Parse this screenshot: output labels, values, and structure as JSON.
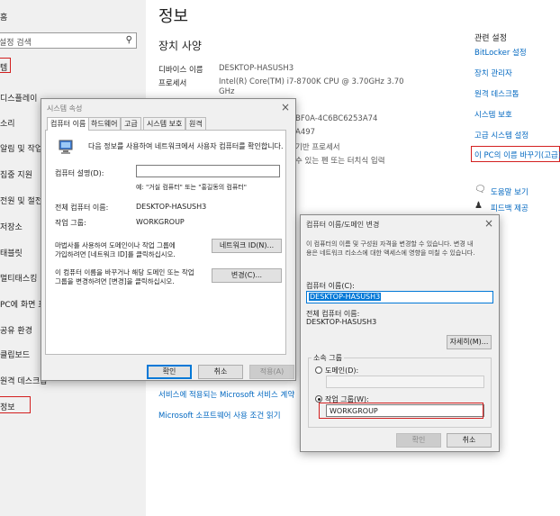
{
  "sidebar": {
    "home": "홈",
    "search_placeholder": "설정 검색",
    "items": [
      {
        "label": "시스템",
        "visible": "템"
      },
      {
        "label": "디스플레이",
        "visible": "디스플레이"
      },
      {
        "label": "소리",
        "visible": "소리"
      },
      {
        "label": "알림 및 작업",
        "visible": "알림 및 작업"
      },
      {
        "label": "집중 지원",
        "visible": "집중 지원"
      },
      {
        "label": "전원 및 절전",
        "visible": "전원 및 절전"
      },
      {
        "label": "저장소",
        "visible": "저장소"
      },
      {
        "label": "태블릿",
        "visible": "태블릿"
      },
      {
        "label": "멀티태스킹",
        "visible": "멀티태스킹"
      },
      {
        "label": "PC에 화면 표시",
        "visible": "PC에 화면 표"
      },
      {
        "label": "공유 환경",
        "visible": "공유 환경"
      },
      {
        "label": "클립보드",
        "visible": "클립보드"
      },
      {
        "label": "원격 데스크톱",
        "visible": "원격 데스크톱"
      },
      {
        "label": "정보",
        "visible": "정보"
      }
    ]
  },
  "main": {
    "title": "정보",
    "spec_heading": "장치 사양",
    "specs": [
      {
        "label": "디바이스 이름",
        "value": "DESKTOP-HASUSH3"
      },
      {
        "label": "프로세서",
        "value": "Intel(R) Core(TM) i7-8700K CPU @ 3.70GHz   3.70",
        "value2": "GHz"
      },
      {
        "label": "",
        "value": "BF0A-4C6BC6253A74"
      },
      {
        "label": "",
        "value": "A497"
      },
      {
        "label": "",
        "value": "기반 프로세서"
      },
      {
        "label": "",
        "value": "수 있는 펜 또는 터치식 입력"
      }
    ],
    "links_bottom": [
      "서비스에 적용되는 Microsoft 서비스 계약",
      "Microsoft 소프트웨어 사용 조건 읽기"
    ]
  },
  "related": {
    "title": "관련 설정",
    "links": [
      "BitLocker 설정",
      "장치 관리자",
      "원격 데스크톱",
      "시스템 보호",
      "고급 시스템 설정",
      "이 PC의 이름 바꾸기(고급)"
    ],
    "help": "도움말 보기",
    "feedback": "피드백 제공"
  },
  "sysprops": {
    "title": "시스템 속성",
    "tabs": [
      "컴퓨터 이름",
      "하드웨어",
      "고급",
      "시스템 보호",
      "원격"
    ],
    "intro": "다음 정보를 사용하여 네트워크에서 사용자 컴퓨터를 확인합니다.",
    "desc_label": "컴퓨터 설명(D):",
    "desc_value": "",
    "example": "예: \"거실 컴퓨터\" 또는 \"홍길동의 컴퓨터\"",
    "full_name_label": "전체 컴퓨터 이름:",
    "full_name": "DESKTOP-HASUSH3",
    "workgroup_label": "작업 그룹:",
    "workgroup": "WORKGROUP",
    "network_text_1": "마법사를 사용하여 도메인이나 작업 그룹에",
    "network_text_2": "가입하려면 [네트워크 ID]를 클릭하십시오.",
    "network_btn": "네트워크 ID(N)...",
    "change_text_1": "이 컴퓨터 이름을 바꾸거나 해당 도메인 또는 작업",
    "change_text_2": "그룹을 변경하려면 [변경]을 클릭하십시오.",
    "change_btn": "변경(C)...",
    "ok": "확인",
    "cancel": "취소",
    "apply": "적용(A)"
  },
  "rename": {
    "title": "컴퓨터 이름/도메인 변경",
    "intro_1": "이 컴퓨터의 이름 및 구성원 자격을 변경할 수 있습니다. 변경 내",
    "intro_2": "용은 네트워크 리소스에 대한 액세스에 영향을 미칠 수 있습니다.",
    "name_label": "컴퓨터 이름(C):",
    "name_value": "DESKTOP-HASUSH3",
    "full_label": "전체 컴퓨터 이름:",
    "full_value": "DESKTOP-HASUSH3",
    "more_btn": "자세히(M)...",
    "member_label": "소속 그룹",
    "domain_label": "도메인(D):",
    "workgroup_label": "작업 그룹(W):",
    "workgroup_value": "WORKGROUP",
    "ok": "확인",
    "cancel": "취소"
  },
  "colors": {
    "accent": "#0067c0",
    "highlight": "#d32020",
    "selection": "#0078d7"
  }
}
